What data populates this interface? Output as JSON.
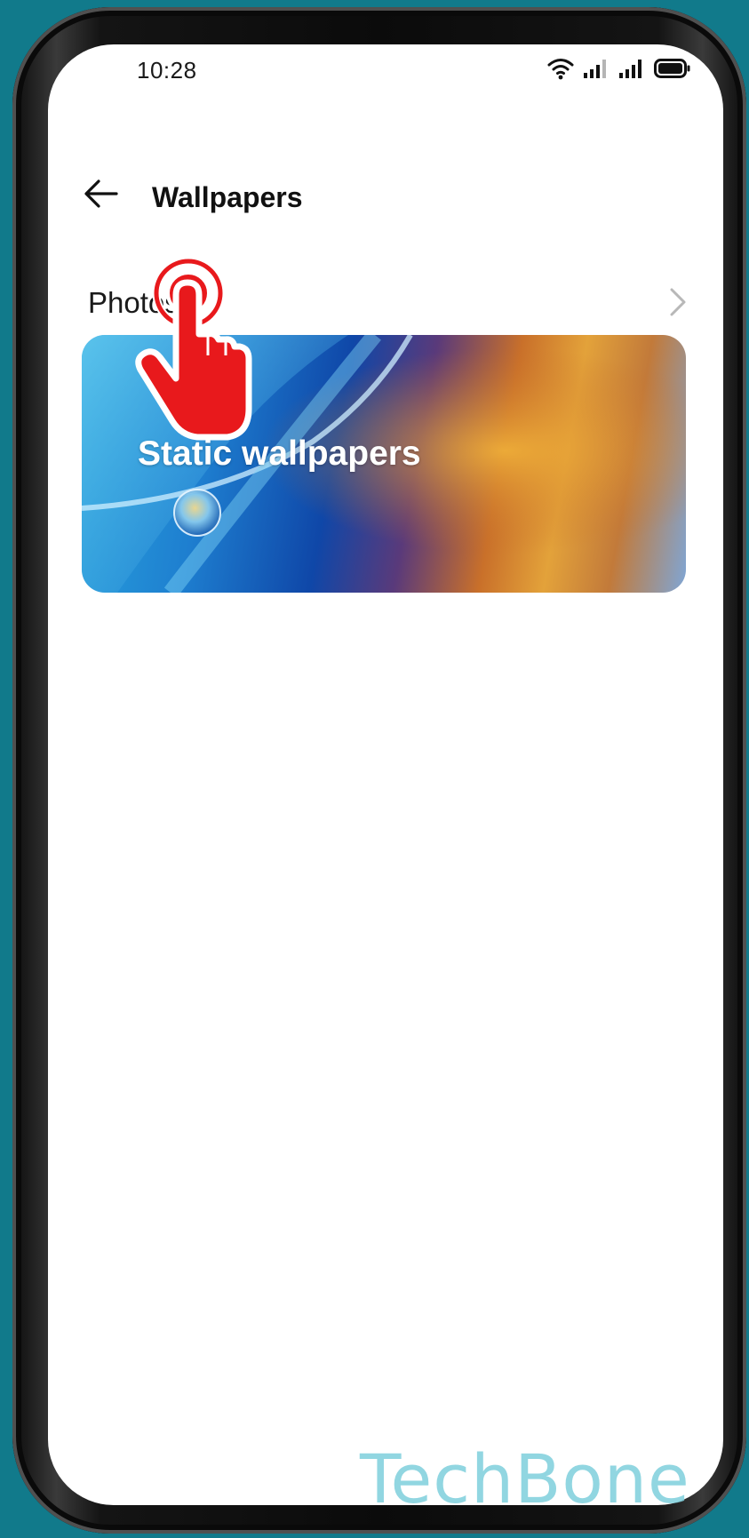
{
  "status_bar": {
    "time": "10:28",
    "icons": [
      "wifi-icon",
      "signal-icon",
      "signal-icon",
      "battery-icon"
    ]
  },
  "header": {
    "back_icon": "arrow-left-icon",
    "title": "Wallpapers"
  },
  "list": {
    "photos_label": "Photos",
    "photos_chevron": "chevron-right-icon"
  },
  "card": {
    "label": "Static wallpapers"
  },
  "overlay": {
    "tap_indicator": "tap-hand-icon",
    "color": "#e8191c"
  },
  "watermark": {
    "text": "TechBone"
  },
  "colors": {
    "background": "#117a8b",
    "screen": "#ffffff",
    "watermark": "#7ecfdc"
  }
}
